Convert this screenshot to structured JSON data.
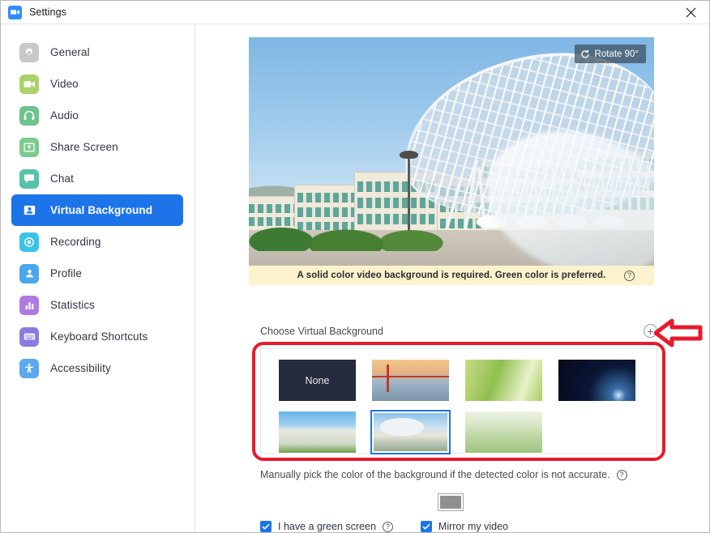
{
  "window": {
    "title": "Settings",
    "app_icon": "zoom-video-icon",
    "close_label": "×"
  },
  "sidebar": {
    "items": [
      {
        "label": "General",
        "icon": "gear-icon",
        "color": "#c9c9c9",
        "active": false
      },
      {
        "label": "Video",
        "icon": "video-camera-icon",
        "color": "#a9d36a",
        "active": false
      },
      {
        "label": "Audio",
        "icon": "headphones-icon",
        "color": "#6dc48b",
        "active": false
      },
      {
        "label": "Share Screen",
        "icon": "share-screen-icon",
        "color": "#7bcb8e",
        "active": false
      },
      {
        "label": "Chat",
        "icon": "chat-bubble-icon",
        "color": "#56c2a8",
        "active": false
      },
      {
        "label": "Virtual Background",
        "icon": "person-card-icon",
        "color": "#1d74e8",
        "active": true
      },
      {
        "label": "Recording",
        "icon": "record-circle-icon",
        "color": "#3ac3e8",
        "active": false
      },
      {
        "label": "Profile",
        "icon": "person-icon",
        "color": "#49a7ef",
        "active": false
      },
      {
        "label": "Statistics",
        "icon": "bar-chart-icon",
        "color": "#b07ae0",
        "active": false
      },
      {
        "label": "Keyboard Shortcuts",
        "icon": "keyboard-icon",
        "color": "#8b7ae0",
        "active": false
      },
      {
        "label": "Accessibility",
        "icon": "accessibility-icon",
        "color": "#5ba8f0",
        "active": false
      }
    ]
  },
  "preview": {
    "rotate_button_label": "Rotate 90°",
    "rotate_icon": "rotate-ccw-icon",
    "notice_text": "A solid color video background is required. Green color is preferred.",
    "notice_help_icon": "question-mark-icon",
    "image_description": "university campus with white lattice canopy"
  },
  "choose": {
    "label": "Choose Virtual Background",
    "add_icon": "plus-circle-icon"
  },
  "backgrounds": {
    "rows": [
      [
        {
          "label": "None",
          "art": "none",
          "selected": false
        },
        {
          "label": "",
          "art": "bridge",
          "selected": false
        },
        {
          "label": "",
          "art": "grass",
          "selected": false
        },
        {
          "label": "",
          "art": "space",
          "selected": false
        }
      ],
      [
        {
          "label": "",
          "art": "campus1",
          "selected": false
        },
        {
          "label": "",
          "art": "campus2",
          "selected": true
        },
        {
          "label": "",
          "art": "campus3",
          "selected": false
        }
      ]
    ]
  },
  "manual": {
    "text": "Manually pick the color of the background if the detected color is not accurate.",
    "help_icon": "question-mark-icon",
    "swatch_color": "#8f8f8f"
  },
  "options": {
    "green_screen_label": "I have a green screen",
    "green_screen_checked": true,
    "green_screen_help_icon": "question-mark-icon",
    "mirror_label": "Mirror my video",
    "mirror_checked": true
  },
  "annotations": {
    "highlight_color": "#e8192c",
    "arrow_direction": "left",
    "arrow_points_to": "plus-circle-icon"
  }
}
